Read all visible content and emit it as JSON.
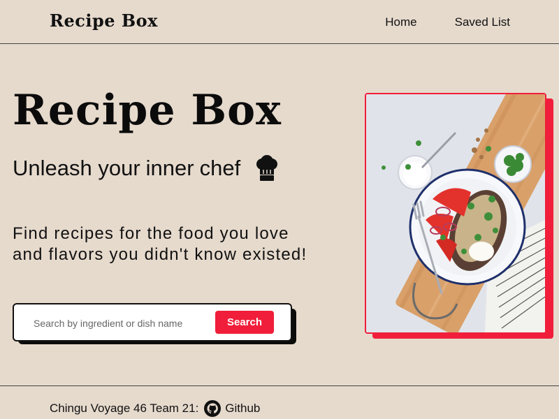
{
  "header": {
    "logo": "Recipe Box",
    "nav": [
      {
        "label": "Home"
      },
      {
        "label": "Saved List"
      }
    ]
  },
  "hero": {
    "title": "Recipe Box",
    "tagline_part1": "Unleash your",
    "tagline_part2": "inner",
    "tagline_part3": "chef",
    "lead_line1": "Find recipes for the food you love",
    "lead_line2": "and flavors you didn't know existed!"
  },
  "search": {
    "placeholder": "Search by ingredient or dish name",
    "value": "",
    "button_label": "Search"
  },
  "footer": {
    "credit": "Chingu Voyage 46 Team 21:",
    "github_label": "Github"
  },
  "colors": {
    "background": "#e6dacd",
    "accent": "#f01e3a",
    "text": "#111111"
  },
  "icons": {
    "chef_hat": "chef-hat-icon",
    "github": "github-icon"
  }
}
